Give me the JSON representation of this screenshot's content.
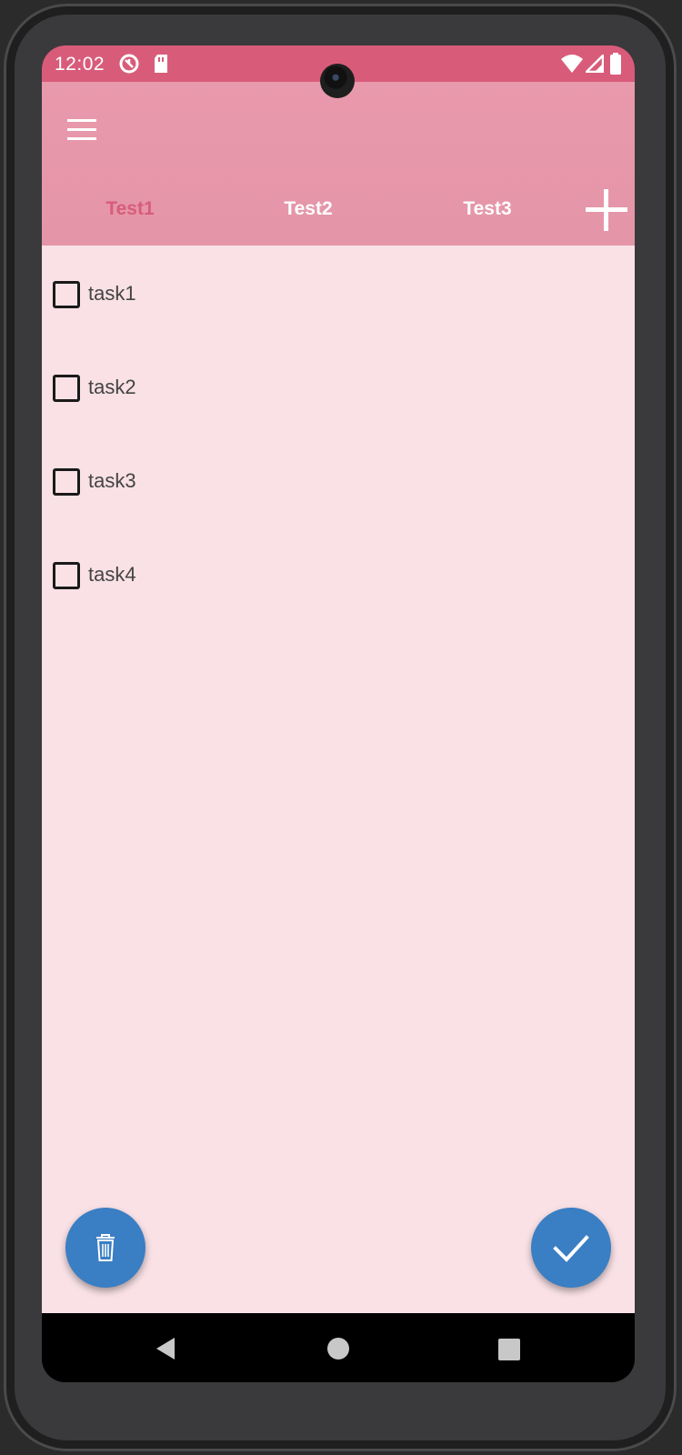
{
  "status_bar": {
    "time": "12:02",
    "icons": [
      "data-saver-icon",
      "sd-card-icon",
      "wifi-icon",
      "signal-icon",
      "battery-icon"
    ]
  },
  "app_bar": {
    "menu_icon": "hamburger-menu-icon",
    "tabs": [
      {
        "label": "Test1",
        "selected": true
      },
      {
        "label": "Test2",
        "selected": false
      },
      {
        "label": "Test3",
        "selected": false
      }
    ],
    "add_tab_icon": "plus-icon"
  },
  "tasks": [
    {
      "label": "task1",
      "checked": false
    },
    {
      "label": "task2",
      "checked": false
    },
    {
      "label": "task3",
      "checked": false
    },
    {
      "label": "task4",
      "checked": false
    }
  ],
  "fabs": {
    "delete_icon": "trash-icon",
    "confirm_icon": "checkmark-icon"
  },
  "nav_bar": {
    "icons": [
      "back-icon",
      "home-icon",
      "recents-icon"
    ]
  },
  "colors": {
    "status_bar": "#d85c7a",
    "app_bar": "#e899ab",
    "active_tab": "#d85c7a",
    "content_bg": "#f9e1e6",
    "fab": "#3a7ec3"
  }
}
